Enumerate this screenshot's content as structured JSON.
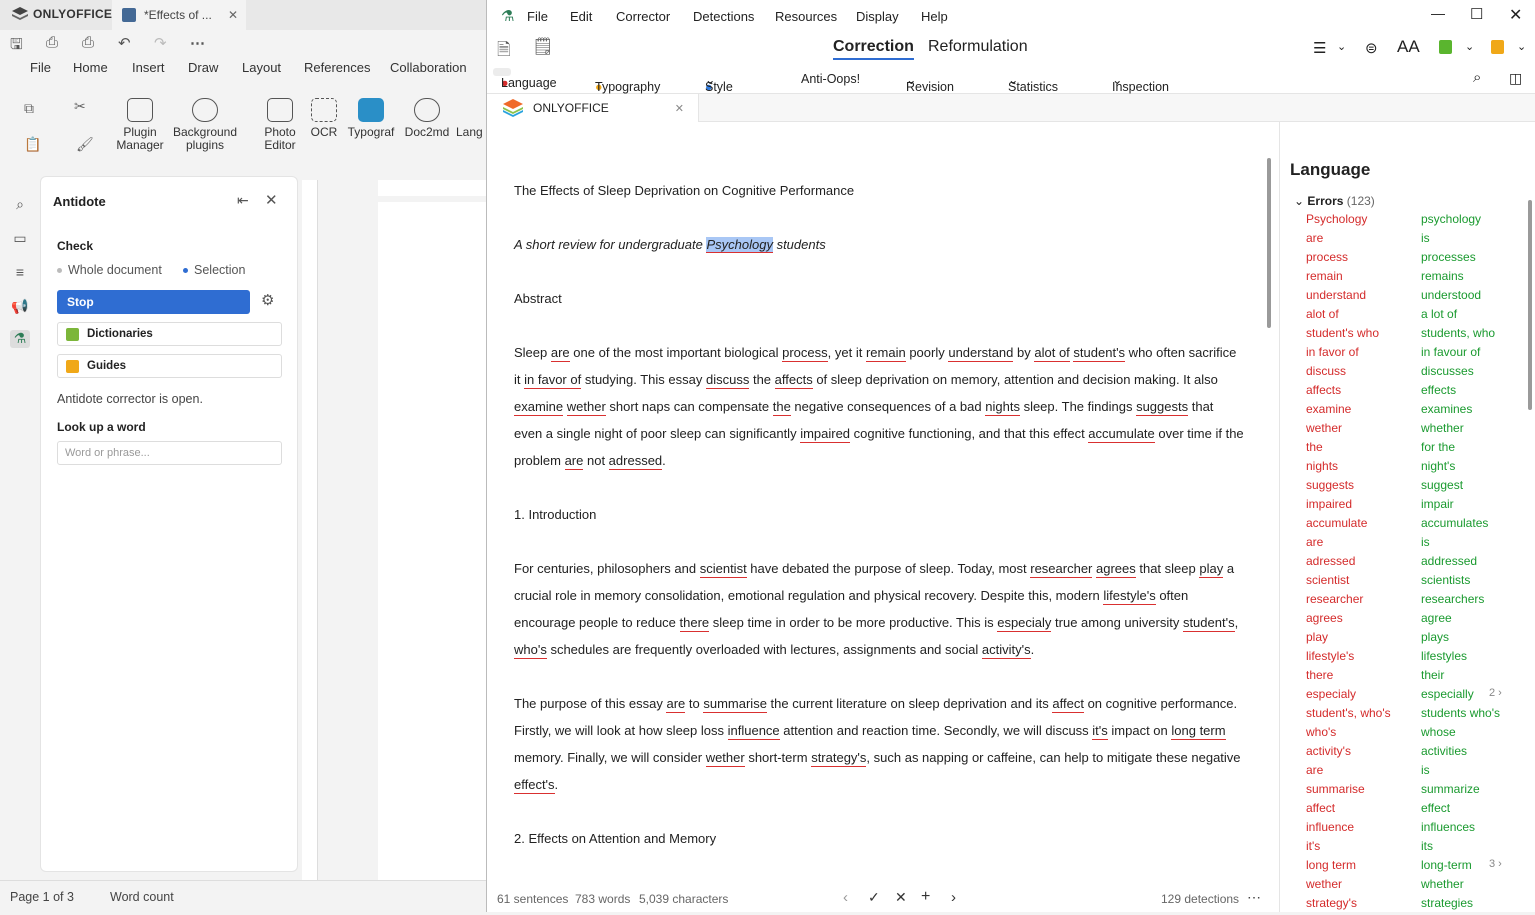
{
  "oo": {
    "brand": "ONLYOFFICE",
    "doc_tab": "*Effects of ...",
    "menu": [
      "File",
      "Home",
      "Insert",
      "Draw",
      "Layout",
      "References",
      "Collaboration"
    ],
    "ribbon": [
      {
        "label": "Plugin\nManager"
      },
      {
        "label": "Background\nplugins"
      },
      {
        "label": "Photo\nEditor"
      },
      {
        "label": "OCR"
      },
      {
        "label": "Typograf"
      },
      {
        "label": "Doc2md"
      },
      {
        "label": "Lang"
      }
    ],
    "status_page": "Page 1 of 3",
    "status_words": "Word count"
  },
  "antidote_panel": {
    "title": "Antidote",
    "check": "Check",
    "opt_whole": "Whole document",
    "opt_selection": "Selection",
    "stop": "Stop",
    "dictionaries": "Dictionaries",
    "guides": "Guides",
    "open_msg": "Antidote corrector is open.",
    "lookup_title": "Look up a word",
    "lookup_placeholder": "Word or phrase..."
  },
  "win": {
    "menu": [
      "File",
      "Edit",
      "Corrector",
      "Detections",
      "Resources",
      "Display",
      "Help"
    ],
    "tab_correction": "Correction",
    "tab_reformulation": "Reformulation",
    "aa": "AA",
    "sub": [
      "Language",
      "Typography",
      "Style",
      "Anti-Oops!",
      "Revision",
      "Statistics",
      "Inspection"
    ],
    "doc_tab": "ONLYOFFICE",
    "status_sentences": "61 sentences",
    "status_words": "783 words",
    "status_chars": "5,039 characters",
    "status_detections": "129 detections"
  },
  "doc": {
    "title": "The Effects of Sleep Deprivation on Cognitive Performance",
    "subtitle": "A short review for undergraduate Psychology students",
    "abstract_h": "Abstract",
    "intro_h": "1. Introduction",
    "effects_h": "2. Effects on Attention and Memory"
  },
  "lang_panel": {
    "title": "Language",
    "errors_label": "Errors",
    "errors_count": "(123)",
    "rows": [
      [
        "Psychology",
        "psychology",
        ""
      ],
      [
        "are",
        "is",
        ""
      ],
      [
        "process",
        "processes",
        ""
      ],
      [
        "remain",
        "remains",
        ""
      ],
      [
        "understand",
        "understood",
        ""
      ],
      [
        "alot of",
        "a lot of",
        ""
      ],
      [
        "student's who",
        "students, who",
        ""
      ],
      [
        "in favor of",
        "in favour of",
        ""
      ],
      [
        "discuss",
        "discusses",
        ""
      ],
      [
        "affects",
        "effects",
        ""
      ],
      [
        "examine",
        "examines",
        ""
      ],
      [
        "wether",
        "whether",
        ""
      ],
      [
        "the",
        "for the",
        ""
      ],
      [
        "nights",
        "night's",
        ""
      ],
      [
        "suggests",
        "suggest",
        ""
      ],
      [
        "impaired",
        "impair",
        ""
      ],
      [
        "accumulate",
        "accumulates",
        ""
      ],
      [
        "are",
        "is",
        ""
      ],
      [
        "adressed",
        "addressed",
        ""
      ],
      [
        "scientist",
        "scientists",
        ""
      ],
      [
        "researcher",
        "researchers",
        ""
      ],
      [
        "agrees",
        "agree",
        ""
      ],
      [
        "play",
        "plays",
        ""
      ],
      [
        "lifestyle's",
        "lifestyles",
        ""
      ],
      [
        "there",
        "their",
        ""
      ],
      [
        "especialy",
        "especially",
        "2"
      ],
      [
        "student's, who's",
        "students who's",
        ""
      ],
      [
        "who's",
        "whose",
        ""
      ],
      [
        "activity's",
        "activities",
        ""
      ],
      [
        "are",
        "is",
        ""
      ],
      [
        "summarise",
        "summarize",
        ""
      ],
      [
        "affect",
        "effect",
        ""
      ],
      [
        "influence",
        "influences",
        ""
      ],
      [
        "it's",
        "its",
        ""
      ],
      [
        "long term",
        "long-term",
        "3"
      ],
      [
        "wether",
        "whether",
        ""
      ],
      [
        "strategy's",
        "strategies",
        ""
      ]
    ]
  }
}
